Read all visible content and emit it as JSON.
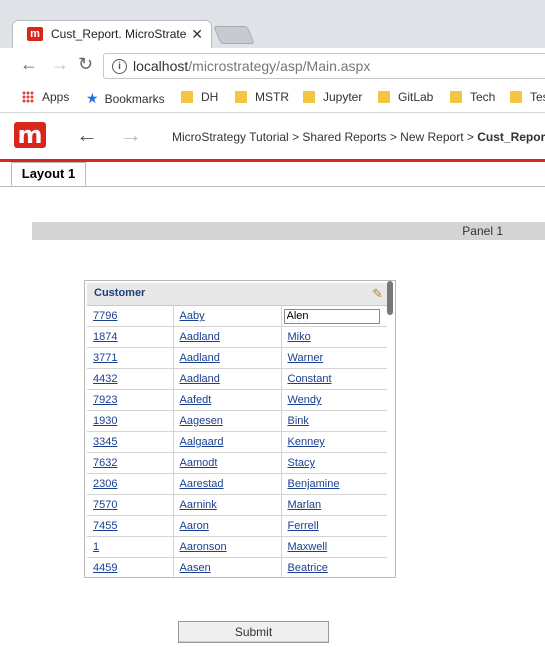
{
  "browser": {
    "tab_title": "Cust_Report. MicroStrate",
    "close_glyph": "✕",
    "url_host": "localhost",
    "url_path": "/microstrategy/asp/Main.aspx",
    "bookmarks": [
      {
        "label": "Apps",
        "icon": "apps-grid-icon"
      },
      {
        "label": "Bookmarks",
        "icon": "star-icon"
      },
      {
        "label": "DH",
        "icon": "folder-icon"
      },
      {
        "label": "MSTR",
        "icon": "folder-icon"
      },
      {
        "label": "Jupyter",
        "icon": "folder-icon"
      },
      {
        "label": "GitLab",
        "icon": "folder-icon"
      },
      {
        "label": "Tech",
        "icon": "folder-icon"
      },
      {
        "label": "Tes",
        "icon": "folder-icon"
      }
    ]
  },
  "app": {
    "logo_letter": "m",
    "breadcrumb": {
      "items": [
        "MicroStrategy Tutorial",
        "Shared Reports",
        "New Report"
      ],
      "separator": ">",
      "current": "Cust_Report"
    },
    "layout_tab": "Layout 1",
    "panel_label": "Panel 1",
    "accent_color": "#d9261c"
  },
  "grid": {
    "title": "Customer",
    "editing_value": "Alen",
    "rows": [
      [
        "7796",
        "Aaby",
        "Alen"
      ],
      [
        "1874",
        "Aadland",
        "Miko"
      ],
      [
        "3771",
        "Aadland",
        "Warner"
      ],
      [
        "4432",
        "Aadland",
        "Constant"
      ],
      [
        "7923",
        "Aafedt",
        "Wendy"
      ],
      [
        "1930",
        "Aagesen",
        "Bink"
      ],
      [
        "3345",
        "Aalgaard",
        "Kenney"
      ],
      [
        "7632",
        "Aamodt",
        "Stacy"
      ],
      [
        "2306",
        "Aarestad",
        "Benjamine"
      ],
      [
        "7570",
        "Aarnink",
        "Marlan"
      ],
      [
        "7455",
        "Aaron",
        "Ferrell"
      ],
      [
        "1",
        "Aaronson",
        "Maxwell"
      ],
      [
        "4459",
        "Aasen",
        "Beatrice"
      ]
    ]
  },
  "submit_label": "Submit"
}
